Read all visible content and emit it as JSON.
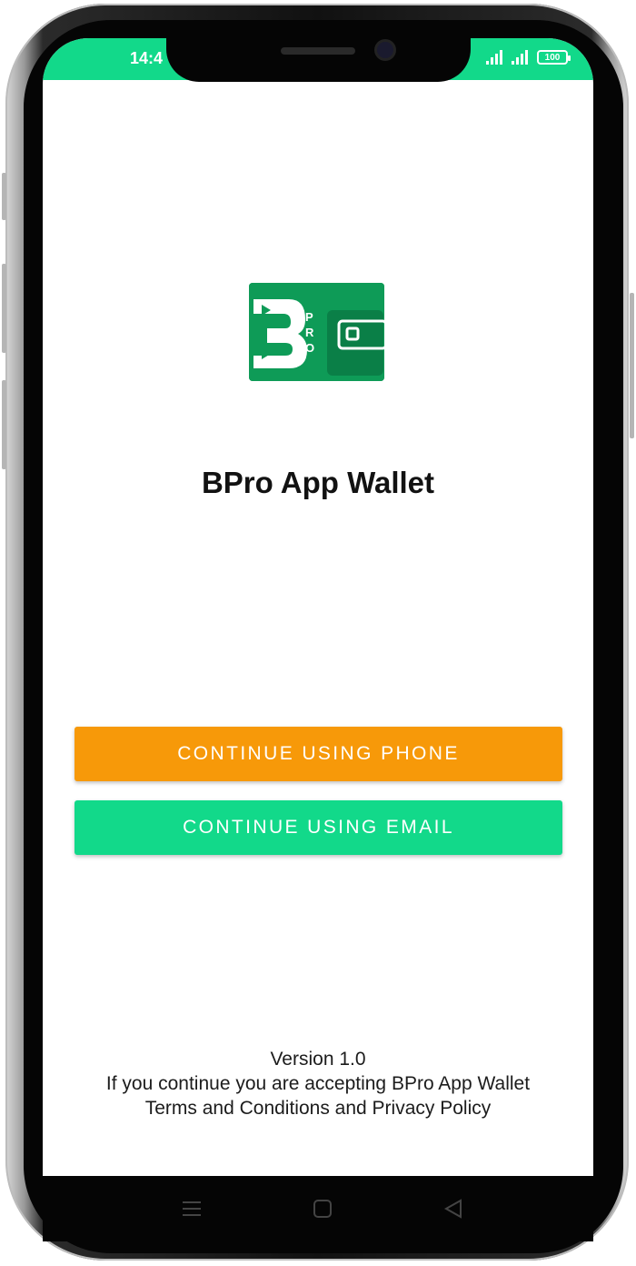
{
  "status_bar": {
    "time": "14:4",
    "battery": "100",
    "bg_color": "#12d98a"
  },
  "app": {
    "title": "BPro App Wallet",
    "logo_letters": "PRO",
    "logo_color": "#0e9b57"
  },
  "buttons": {
    "phone": {
      "label": "CONTINUE USING PHONE",
      "color": "#f79909"
    },
    "email": {
      "label": "CONTINUE USING EMAIL",
      "color": "#12d98a"
    }
  },
  "footer": {
    "version": "Version 1.0",
    "line1": "If you continue you are accepting BPro App Wallet",
    "line2": "Terms and Conditions and Privacy Policy"
  },
  "nav_bar": {
    "icons": [
      "menu-icon",
      "home-icon",
      "back-icon"
    ]
  }
}
